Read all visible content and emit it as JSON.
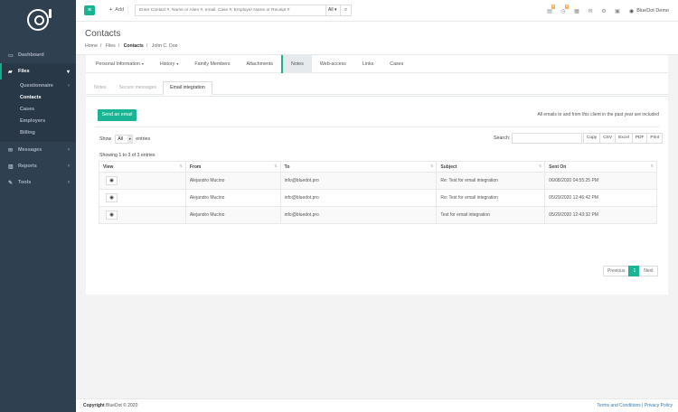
{
  "topbar": {
    "add_label": "Add",
    "search_placeholder": "Enter Contact #, Name or Alien #, email, Case #, Employer Name or Receipt #",
    "search_scope": "All",
    "badge1": "6",
    "badge2": "0",
    "user_name": "BlueDot Demo"
  },
  "sidebar": {
    "dashboard": "Dashboard",
    "files": "Files",
    "questionnaire": "Questionnaire",
    "contacts": "Contacts",
    "cases": "Cases",
    "employers": "Employers",
    "billing": "Billing",
    "messages": "Messages",
    "reports": "Reports",
    "tools": "Tools"
  },
  "header": {
    "title": "Contacts",
    "crumb_home": "Home",
    "crumb_files": "Files",
    "crumb_contacts": "Contacts",
    "crumb_name": "John C. Doe"
  },
  "tabs": {
    "personal": "Personal Information",
    "history": "History",
    "family": "Family Members",
    "attachments": "Attachments",
    "notes": "Notes",
    "web": "Web-access",
    "links": "Links",
    "cases": "Cases"
  },
  "subtabs": {
    "notes": "Notes",
    "secure": "Secure messages",
    "email": "Email integration"
  },
  "content": {
    "send_button": "Send an email",
    "note": "All emails to and from this client in the past year are included",
    "show_label": "Show",
    "show_value": "All",
    "entries_label": "entries",
    "search_label": "Search:",
    "exports": [
      "Copy",
      "CSV",
      "Excel",
      "PDF",
      "Print"
    ],
    "showing": "Showing 1 to 3 of 3 entries"
  },
  "table": {
    "headers": [
      "View",
      "From",
      "To",
      "Subject",
      "Sent On"
    ],
    "rows": [
      {
        "from": "Alejandro Mucino",
        "to": "info@bluedot.pro",
        "subject": "Re: Test for email integration",
        "sent": "06/08/2020 04:55:25 PM"
      },
      {
        "from": "Alejandro Mucino",
        "to": "info@bluedot.pro",
        "subject": "Re: Test for email integration",
        "sent": "05/29/2020 12:46:42 PM"
      },
      {
        "from": "Alejandro Mucino",
        "to": "info@bluedot.pro",
        "subject": "Test for email integration",
        "sent": "05/29/2020 12:43:32 PM"
      }
    ]
  },
  "pager": {
    "previous": "Previous",
    "page": "1",
    "next": "Next"
  },
  "footer": {
    "copyright_bold": "Copyright",
    "copyright_rest": "BlueDot © 2020",
    "terms": "Terms and Conditions",
    "sep": "|",
    "privacy": "Privacy Policy"
  },
  "colors": {
    "accent": "#1ab394",
    "sidebar": "#2f4050",
    "badge": "#f8ac59"
  }
}
